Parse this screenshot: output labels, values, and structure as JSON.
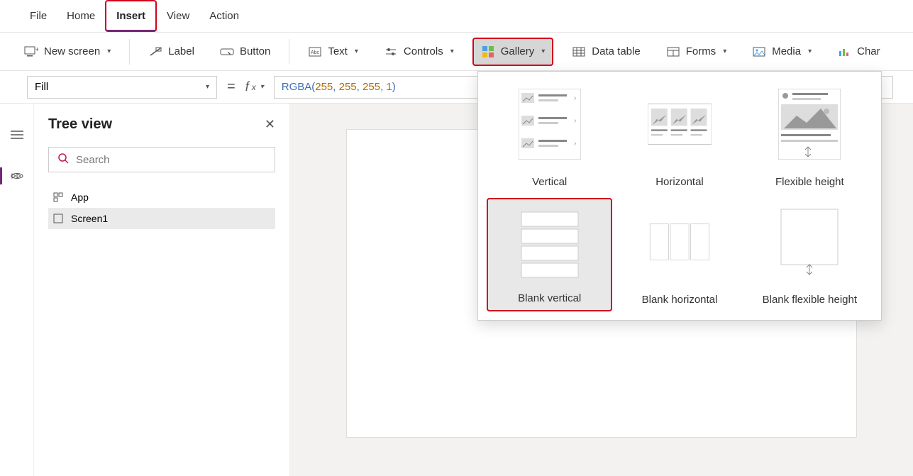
{
  "menu": {
    "file": "File",
    "home": "Home",
    "insert": "Insert",
    "view": "View",
    "action": "Action"
  },
  "ribbon": {
    "new_screen": "New screen",
    "label": "Label",
    "button": "Button",
    "text": "Text",
    "controls": "Controls",
    "gallery": "Gallery",
    "data_table": "Data table",
    "forms": "Forms",
    "media": "Media",
    "charts": "Char"
  },
  "formula": {
    "property": "Fill",
    "fn": "RGBA",
    "args": [
      "255",
      "255",
      "255",
      "1"
    ]
  },
  "tree": {
    "title": "Tree view",
    "search_placeholder": "Search",
    "items": [
      {
        "label": "App"
      },
      {
        "label": "Screen1"
      }
    ]
  },
  "gallery_menu": {
    "items": [
      {
        "label": "Vertical"
      },
      {
        "label": "Horizontal"
      },
      {
        "label": "Flexible height"
      },
      {
        "label": "Blank vertical"
      },
      {
        "label": "Blank horizontal"
      },
      {
        "label": "Blank flexible height"
      }
    ]
  }
}
